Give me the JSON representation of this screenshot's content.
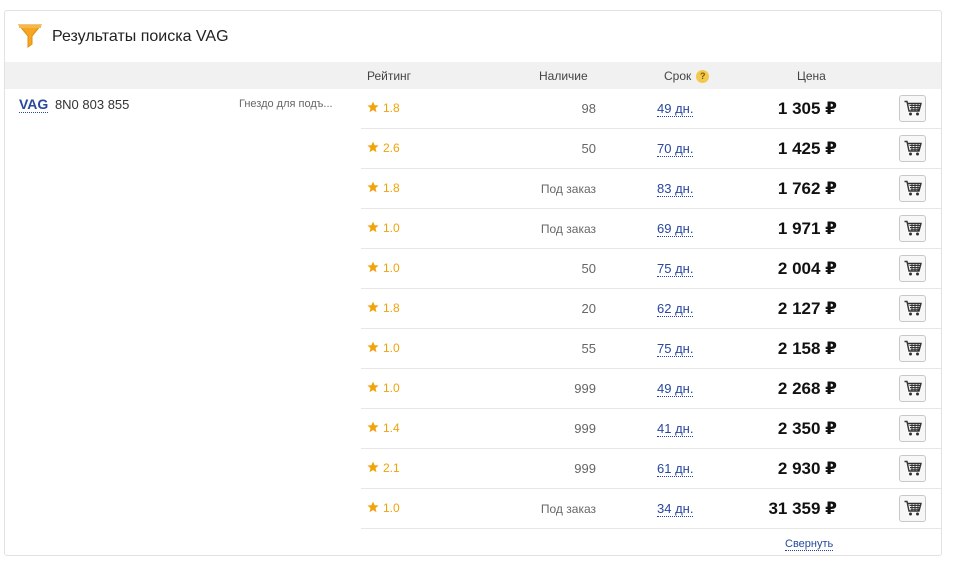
{
  "header": {
    "title": "Результаты поиска VAG"
  },
  "columns": {
    "rating": "Рейтинг",
    "availability": "Наличие",
    "term": "Срок",
    "term_help": "?",
    "price": "Цена"
  },
  "part": {
    "brand": "VAG",
    "article": "8N0 803 855",
    "description": "Гнездо для подъ..."
  },
  "offers": [
    {
      "rating": "1.8",
      "availability": "98",
      "term": "49 дн.",
      "price": "1 305 ₽"
    },
    {
      "rating": "2.6",
      "availability": "50",
      "term": "70 дн.",
      "price": "1 425 ₽"
    },
    {
      "rating": "1.8",
      "availability": "Под заказ",
      "term": "83 дн.",
      "price": "1 762 ₽"
    },
    {
      "rating": "1.0",
      "availability": "Под заказ",
      "term": "69 дн.",
      "price": "1 971 ₽"
    },
    {
      "rating": "1.0",
      "availability": "50",
      "term": "75 дн.",
      "price": "2 004 ₽"
    },
    {
      "rating": "1.8",
      "availability": "20",
      "term": "62 дн.",
      "price": "2 127 ₽"
    },
    {
      "rating": "1.0",
      "availability": "55",
      "term": "75 дн.",
      "price": "2 158 ₽"
    },
    {
      "rating": "1.0",
      "availability": "999",
      "term": "49 дн.",
      "price": "2 268 ₽"
    },
    {
      "rating": "1.4",
      "availability": "999",
      "term": "41 дн.",
      "price": "2 350 ₽"
    },
    {
      "rating": "2.1",
      "availability": "999",
      "term": "61 дн.",
      "price": "2 930 ₽"
    },
    {
      "rating": "1.0",
      "availability": "Под заказ",
      "term": "34 дн.",
      "price": "31 359 ₽"
    }
  ],
  "footer": {
    "collapse_label": "Свернуть"
  },
  "icons": {
    "title_icon": "filter-icon",
    "rating_icon": "star-icon",
    "cart_icon": "cart-icon"
  },
  "colors": {
    "accent_orange": "#f0a30a",
    "link_blue": "#27489e",
    "header_bg": "#f1f1f1"
  }
}
